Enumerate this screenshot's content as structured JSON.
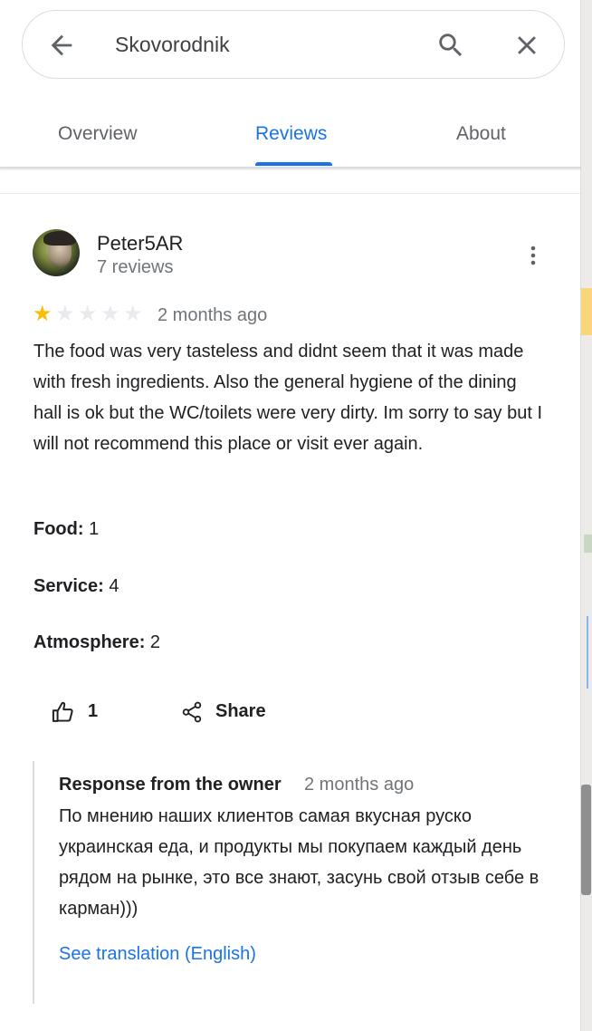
{
  "search": {
    "query": "Skovorodnik",
    "back_icon": "arrow-back-icon",
    "search_icon": "search-icon",
    "close_icon": "close-icon"
  },
  "tabs": [
    {
      "label": "Overview",
      "active": false
    },
    {
      "label": "Reviews",
      "active": true
    },
    {
      "label": "About",
      "active": false
    }
  ],
  "review": {
    "author": "Peter5AR",
    "author_meta": "7 reviews",
    "rating": 1,
    "max_rating": 5,
    "date": "2 months ago",
    "text": "The food was very tasteless and didnt seem that it was made with fresh ingredients. Also the general hygiene of the dining hall is ok but the WC/toilets were very dirty. Im sorry to say but I will not recommend this place or visit ever again.",
    "ratings": {
      "food_label": "Food:",
      "food_value": "1",
      "service_label": "Service:",
      "service_value": "4",
      "atmosphere_label": "Atmosphere:",
      "atmosphere_value": "2"
    },
    "likes": "1",
    "share_label": "Share"
  },
  "owner_response": {
    "title": "Response from the owner",
    "date": "2 months ago",
    "text": "По мнению наших клиентов самая вкусная руско украинская еда, и продукты мы покупаем каждый день рядом на рынке, это все знают, засунь свой отзыв себе в карман)))",
    "translation_link": "See translation (English)"
  },
  "colors": {
    "accent": "#1a73e8",
    "star_filled": "#fbbc04",
    "star_empty": "#e8eaed",
    "secondary_text": "#70757a"
  }
}
